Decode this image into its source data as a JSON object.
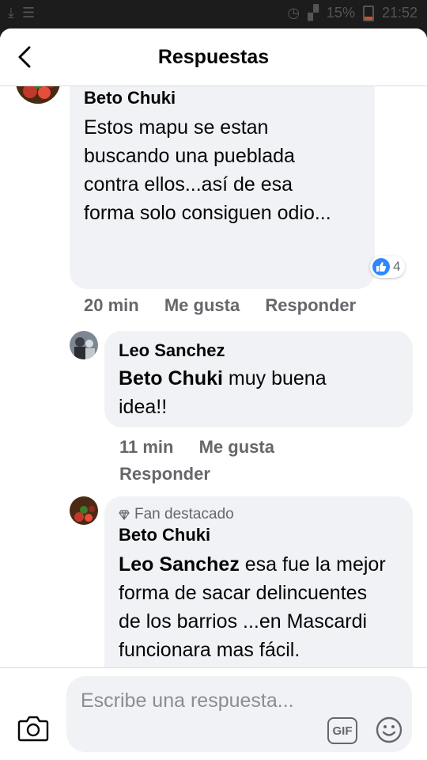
{
  "status_bar": {
    "time": "21:52",
    "battery": "15%"
  },
  "header": {
    "title": "Respuestas"
  },
  "comments": [
    {
      "author": "Beto Chuki",
      "text": "Estos mapu se estan buscando una pueblada contra ellos...así de esa forma solo consiguen odio...",
      "reactions_count": "4",
      "time": "20 min",
      "like_label": "Me gusta",
      "reply_label": "Responder"
    },
    {
      "author": "Leo Sanchez",
      "mention": "Beto Chuki",
      "text": " muy buena idea!!",
      "time": "11 min",
      "like_label": "Me gusta",
      "reply_label": "Responder"
    },
    {
      "badge": "Fan destacado",
      "author": "Beto Chuki",
      "mention": "Leo Sanchez",
      "text": " esa fue la mejor forma de sacar delincuentes de los barrios ...en Mascardi funcionara mas fácil."
    }
  ],
  "composer": {
    "placeholder": "Escribe una respuesta...",
    "gif_label": "GIF"
  },
  "colors": {
    "bubble": "#f0f2f5",
    "meta": "#65676b",
    "like_blue": "#2d88ff"
  }
}
